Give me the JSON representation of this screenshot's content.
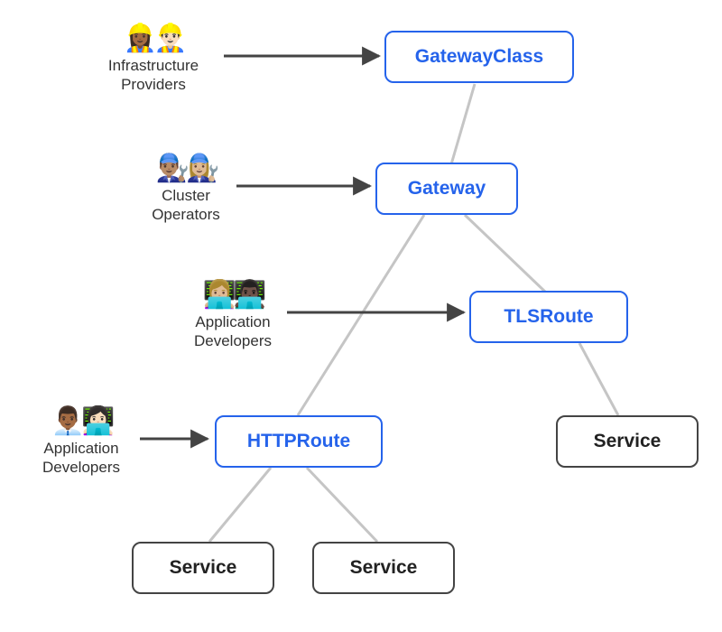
{
  "resources": {
    "gatewayclass": "GatewayClass",
    "gateway": "Gateway",
    "tlsroute": "TLSRoute",
    "httproute": "HTTPRoute"
  },
  "services": {
    "svc1": "Service",
    "svc2": "Service",
    "svc3": "Service"
  },
  "personas": {
    "infra": {
      "emojis": "👷🏾‍♀️👷🏻‍♂️",
      "label_line1": "Infrastructure",
      "label_line2": "Providers"
    },
    "cluster": {
      "emojis": "👨🏽‍🔧👩🏼‍🔧",
      "label_line1": "Cluster",
      "label_line2": "Operators"
    },
    "appdev1": {
      "emojis": "👩🏼‍💻👨🏿‍💻",
      "label_line1": "Application",
      "label_line2": "Developers"
    },
    "appdev2": {
      "emojis": "👨🏾‍💼👩🏻‍💻",
      "label_line1": "Application",
      "label_line2": "Developers"
    }
  }
}
